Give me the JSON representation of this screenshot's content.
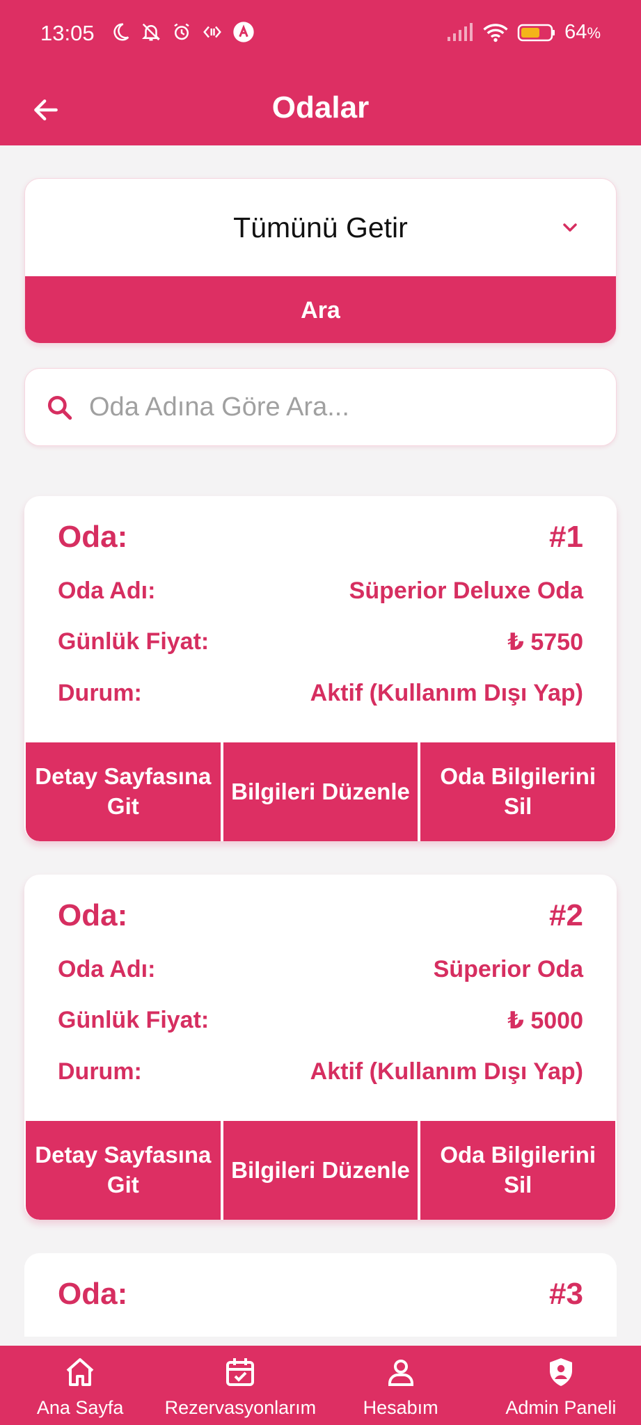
{
  "status_bar": {
    "time": "13:05",
    "battery": "64",
    "battery_unit": "%"
  },
  "app_bar": {
    "title": "Odalar"
  },
  "filter": {
    "selected": "Tümünü Getir",
    "search_button": "Ara"
  },
  "search": {
    "placeholder": "Oda Adına Göre Ara..."
  },
  "labels": {
    "room": "Oda:",
    "name": "Oda Adı:",
    "price": "Günlük Fiyat:",
    "status": "Durum:"
  },
  "actions": {
    "detail": "Detay Sayfasına Git",
    "edit": "Bilgileri Düzenle",
    "delete": "Oda Bilgilerini Sil"
  },
  "rooms": [
    {
      "number": "#1",
      "name": "Süperior Deluxe Oda",
      "price": "₺ 5750",
      "status": "Aktif (Kullanım Dışı Yap)"
    },
    {
      "number": "#2",
      "name": "Süperior Oda",
      "price": "₺ 5000",
      "status": "Aktif (Kullanım Dışı Yap)"
    },
    {
      "number": "#3"
    }
  ],
  "bottom_nav": {
    "home": "Ana Sayfa",
    "reservations": "Rezervasyonlarım",
    "account": "Hesabım",
    "admin": "Admin Paneli"
  },
  "colors": {
    "primary": "#dd2f63",
    "text_accent": "#d62e60",
    "background": "#f4f3f4"
  }
}
